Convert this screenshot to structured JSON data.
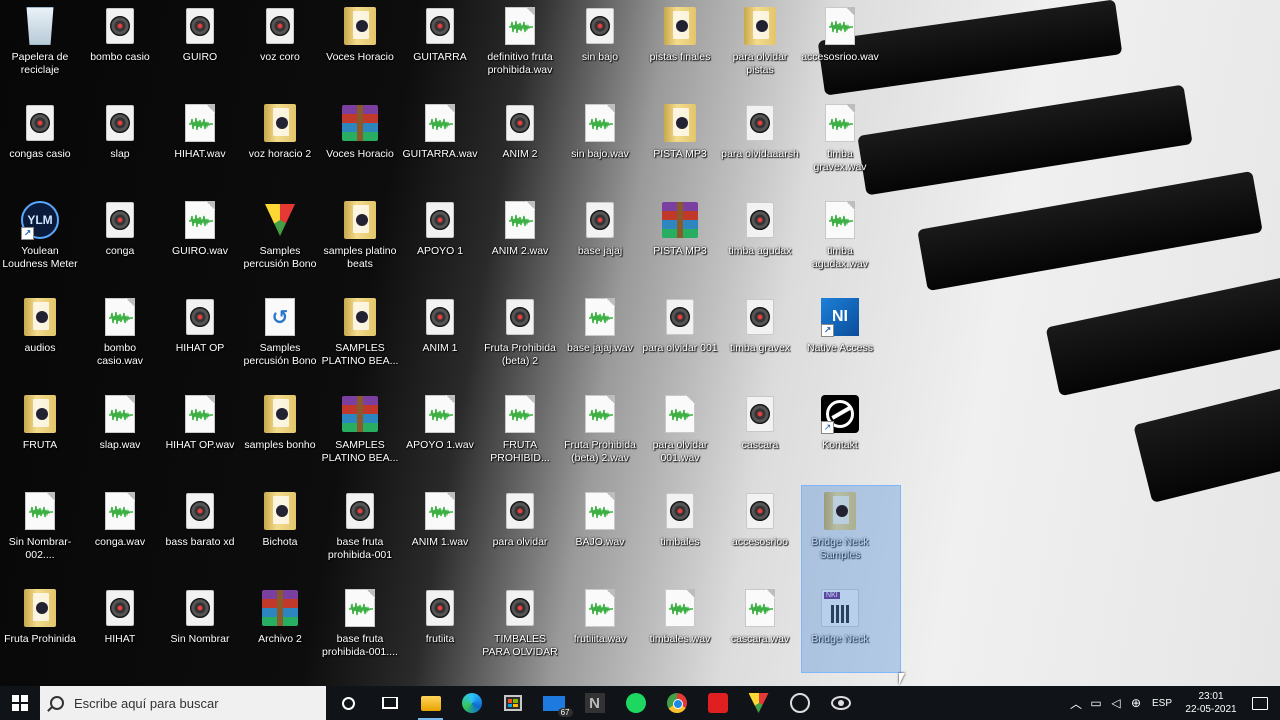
{
  "desktop": {
    "icons": [
      {
        "label": "Papelera de reciclaje",
        "type": "recycle"
      },
      {
        "label": "bombo casio",
        "type": "disc"
      },
      {
        "label": "GUIRO",
        "type": "disc"
      },
      {
        "label": "voz coro",
        "type": "disc"
      },
      {
        "label": "Voces Horacio",
        "type": "folder"
      },
      {
        "label": "GUITARRA",
        "type": "disc"
      },
      {
        "label": "definitivo fruta prohibida.wav",
        "type": "wave"
      },
      {
        "label": "sin bajo",
        "type": "disc"
      },
      {
        "label": "pistas finales",
        "type": "folder"
      },
      {
        "label": "para olvidar pistas",
        "type": "folder"
      },
      {
        "label": "accesosrioo.wav",
        "type": "wave"
      },
      {
        "label": "congas casio",
        "type": "disc"
      },
      {
        "label": "slap",
        "type": "disc"
      },
      {
        "label": "HIHAT.wav",
        "type": "wave"
      },
      {
        "label": "voz horacio 2",
        "type": "folder"
      },
      {
        "label": "Voces Horacio",
        "type": "rar"
      },
      {
        "label": "GUITARRA.wav",
        "type": "wave"
      },
      {
        "label": "ANIM 2",
        "type": "disc"
      },
      {
        "label": "sin bajo.wav",
        "type": "wave"
      },
      {
        "label": "PISTA MP3",
        "type": "folder"
      },
      {
        "label": "para olvidaaarsh",
        "type": "disc"
      },
      {
        "label": "timba gravex.wav",
        "type": "wave"
      },
      {
        "label": "Youlean Loudness Meter 2",
        "type": "ylm"
      },
      {
        "label": "conga",
        "type": "disc"
      },
      {
        "label": "GUIRO.wav",
        "type": "wave"
      },
      {
        "label": "Samples percusión Bono",
        "type": "bono"
      },
      {
        "label": "samples platino beats",
        "type": "folder"
      },
      {
        "label": "APOYO 1",
        "type": "disc"
      },
      {
        "label": "ANIM 2.wav",
        "type": "wave"
      },
      {
        "label": "base jajaj",
        "type": "disc"
      },
      {
        "label": "PISTA MP3",
        "type": "rar"
      },
      {
        "label": "timba agudax",
        "type": "disc"
      },
      {
        "label": "timba agudax.wav",
        "type": "wave"
      },
      {
        "label": "audios",
        "type": "folder"
      },
      {
        "label": "bombo casio.wav",
        "type": "wave"
      },
      {
        "label": "HIHAT OP",
        "type": "disc"
      },
      {
        "label": "Samples percusión Bono",
        "type": "doc"
      },
      {
        "label": "SAMPLES PLATINO BEA...",
        "type": "folder"
      },
      {
        "label": "ANIM 1",
        "type": "disc"
      },
      {
        "label": "Fruta Prohibida (beta) 2",
        "type": "disc"
      },
      {
        "label": "base jajaj.wav",
        "type": "wave"
      },
      {
        "label": "para olvidar 001",
        "type": "disc"
      },
      {
        "label": "timba gravex",
        "type": "disc"
      },
      {
        "label": "Native Access",
        "type": "na"
      },
      {
        "label": "FRUTA",
        "type": "folder"
      },
      {
        "label": "slap.wav",
        "type": "wave"
      },
      {
        "label": "HIHAT OP.wav",
        "type": "wave"
      },
      {
        "label": "samples bonho",
        "type": "folder"
      },
      {
        "label": "SAMPLES PLATINO BEA...",
        "type": "rar"
      },
      {
        "label": "APOYO 1.wav",
        "type": "wave"
      },
      {
        "label": "FRUTA PROHIBID...",
        "type": "wave"
      },
      {
        "label": "Fruta Prohibida (beta) 2.wav",
        "type": "wave"
      },
      {
        "label": "para olvidar 001.wav",
        "type": "wave"
      },
      {
        "label": "cascara",
        "type": "disc"
      },
      {
        "label": "Kontakt",
        "type": "kontakt"
      },
      {
        "label": "Sin Nombrar-002....",
        "type": "wave"
      },
      {
        "label": "conga.wav",
        "type": "wave"
      },
      {
        "label": "bass barato xd",
        "type": "disc"
      },
      {
        "label": "Bichota",
        "type": "folder"
      },
      {
        "label": "base fruta prohibida-001",
        "type": "disc"
      },
      {
        "label": "ANIM 1.wav",
        "type": "wave"
      },
      {
        "label": "para olvidar",
        "type": "disc"
      },
      {
        "label": "BAJO.wav",
        "type": "wave"
      },
      {
        "label": "timbales",
        "type": "disc"
      },
      {
        "label": "accesosrioo",
        "type": "disc"
      },
      {
        "label": "Bridge Neck Samples",
        "type": "folder"
      },
      {
        "label": "Fruta Prohinida",
        "type": "folder"
      },
      {
        "label": "HIHAT",
        "type": "disc"
      },
      {
        "label": "Sin Nombrar",
        "type": "disc"
      },
      {
        "label": "Archivo 2",
        "type": "rar"
      },
      {
        "label": "base fruta prohibida-001....",
        "type": "wave"
      },
      {
        "label": "frutiita",
        "type": "disc"
      },
      {
        "label": "TIMBALES PARA OLVIDAR",
        "type": "disc"
      },
      {
        "label": "frutiiita.wav",
        "type": "wave"
      },
      {
        "label": "timbales.wav",
        "type": "wave"
      },
      {
        "label": "cascara.wav",
        "type": "wave"
      },
      {
        "label": "Bridge Neck",
        "type": "nki"
      }
    ]
  },
  "taskbar": {
    "search_placeholder": "Escribe aquí para buscar",
    "mail_badge": "67",
    "apps": [
      "cortana-icon",
      "task-view-icon",
      "file-explorer-icon",
      "edge-icon",
      "store-icon",
      "mail-icon",
      "n-app-icon",
      "spotify-icon",
      "chrome-icon",
      "acrobat-icon",
      "bono-icon",
      "circle-app-icon",
      "eye-app-icon"
    ],
    "tray": {
      "language": "ESP",
      "time": "23:01",
      "date": "22-05-2021"
    }
  },
  "colors": {
    "taskbar_bg": "#101418",
    "selection": "#3c82dc",
    "wave_green": "#3cb043"
  }
}
